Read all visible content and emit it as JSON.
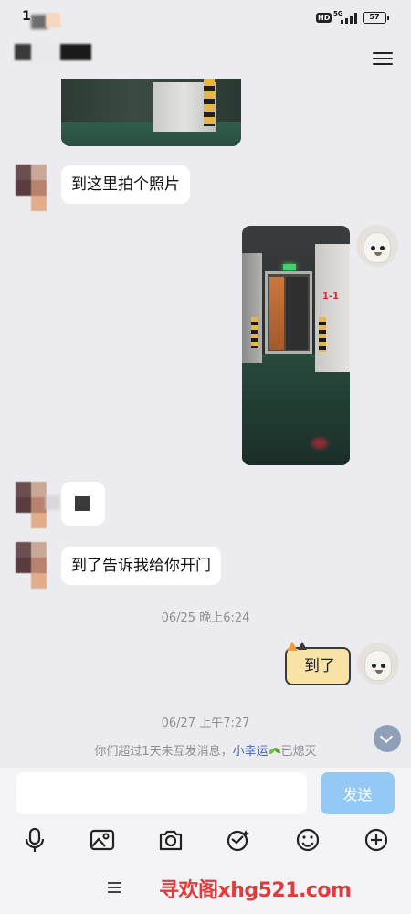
{
  "status_bar": {
    "time": "1",
    "network_hd": "HD",
    "network_5g": "5G",
    "battery": "57"
  },
  "messages": [
    {
      "from": "contact",
      "type": "image",
      "content": "parking garage pillar photo"
    },
    {
      "from": "contact",
      "type": "text",
      "text": "到这里拍个照片"
    },
    {
      "from": "me",
      "type": "image",
      "content": "door photo",
      "label": "1-1"
    },
    {
      "from": "contact",
      "type": "text_blurred",
      "text": ""
    },
    {
      "from": "contact",
      "type": "text",
      "text": "到了告诉我给你开门"
    },
    {
      "type": "timestamp",
      "text": "06/25 晚上6:24"
    },
    {
      "from": "me",
      "type": "sticker",
      "text": "到了"
    },
    {
      "type": "timestamp",
      "text": "06/27 上午7:27"
    }
  ],
  "notice": {
    "prefix": "你们超过1天未互发消息，",
    "friendship_name": "小幸运",
    "suffix": "已熄灭"
  },
  "composer": {
    "input_value": "",
    "send_label": "发送"
  },
  "toolbar": {
    "icons": [
      "microphone-icon",
      "image-icon",
      "camera-icon",
      "red-packet-icon",
      "emoji-icon",
      "plus-icon"
    ]
  },
  "watermark": "寻欢阁xhg521.com",
  "colors": {
    "background": "#ececf0",
    "send_button": "#94c8f5",
    "watermark": "#e23b3b",
    "friend_name": "#3f63b6"
  }
}
